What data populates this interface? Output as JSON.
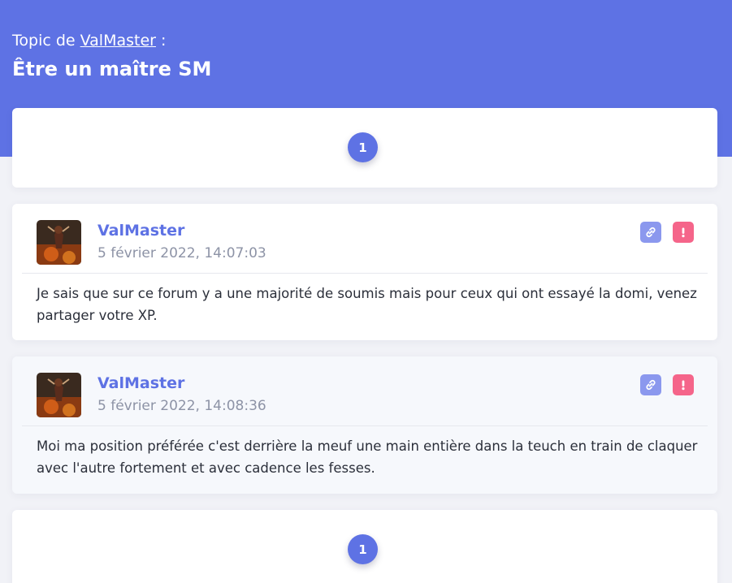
{
  "topic": {
    "prefix": "Topic de",
    "author": "ValMaster",
    "suffix": ":",
    "title": "Être un maître SM"
  },
  "pagination": {
    "top_page": "1",
    "bottom_page": "1"
  },
  "posts": [
    {
      "author": "ValMaster",
      "date": "5 février 2022, 14:07:03",
      "text": "Je sais que sur ce forum y a une majorité de soumis mais pour ceux qui ont essayé la domi, venez partager votre XP."
    },
    {
      "author": "ValMaster",
      "date": "5 février 2022, 14:08:36",
      "text": "Moi ma position préférée c'est derrière la meuf une main entière dans la teuch en train de claquer avec l'autre fortement et avec cadence les fesses."
    }
  ],
  "icons": {
    "link": "link-icon",
    "report": "exclamation-icon"
  },
  "colors": {
    "accent": "#5e72e4",
    "report": "#f5658a",
    "link_button": "#8b98ee"
  }
}
